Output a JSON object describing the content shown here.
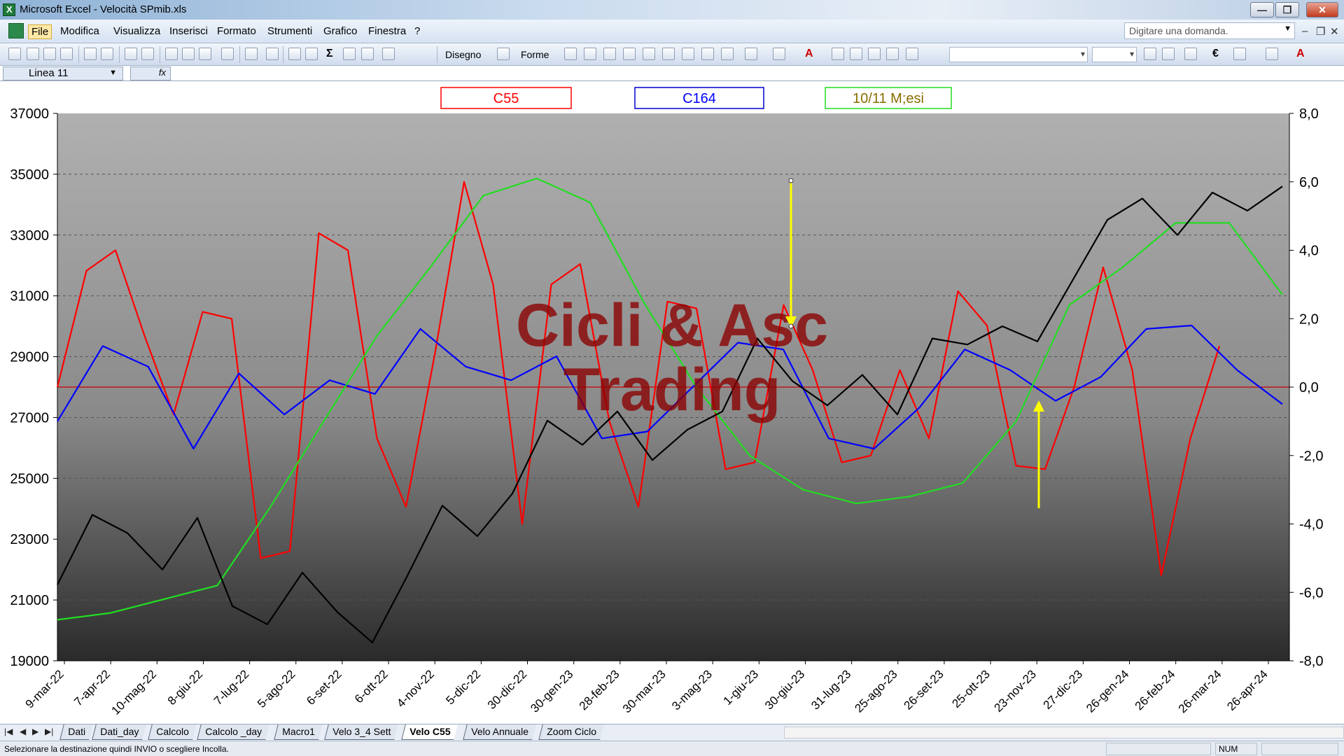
{
  "window": {
    "title": "Microsoft Excel - Velocità SPmib.xls",
    "buttons": [
      "minimize",
      "restore",
      "close"
    ]
  },
  "menu": {
    "items": [
      "File",
      "Modifica",
      "Visualizza",
      "Inserisci",
      "Formato",
      "Strumenti",
      "Grafico",
      "Finestra",
      "?"
    ],
    "active": "File",
    "question_placeholder": "Digitare una domanda."
  },
  "toolbar": {
    "draw_label": "Disegno",
    "shapes_label": "Forme",
    "sum_glyph": "Σ",
    "euro_glyph": "€",
    "font_color_glyph": "A"
  },
  "formula_bar": {
    "name_box": "Linea 11",
    "fx": "fx"
  },
  "chart_data": {
    "type": "line",
    "legend": [
      "C55",
      "C164",
      "10/11 M;esi"
    ],
    "watermark": [
      "Cicli & Asc",
      "Trading"
    ],
    "y_left": {
      "ticks": [
        "37000",
        "35000",
        "33000",
        "31000",
        "29000",
        "27000",
        "25000",
        "23000",
        "21000",
        "19000"
      ],
      "range": [
        19000,
        37000
      ]
    },
    "y_right": {
      "ticks": [
        "8,0",
        "6,0",
        "4,0",
        "2,0",
        "0,0",
        "-2,0",
        "-4,0",
        "-6,0",
        "-8,0"
      ],
      "range": [
        -8,
        8
      ]
    },
    "x_labels": [
      "9-mar-22",
      "7-apr-22",
      "10-mag-22",
      "8-giu-22",
      "7-lug-22",
      "5-ago-22",
      "6-set-22",
      "6-ott-22",
      "4-nov-22",
      "5-dic-22",
      "30-dic-22",
      "30-gen-23",
      "28-feb-23",
      "30-mar-23",
      "3-mag-23",
      "1-giu-23",
      "30-giu-23",
      "31-lug-23",
      "25-ago-23",
      "26-set-23",
      "25-ott-23",
      "23-nov-23",
      "27-dic-23",
      "26-gen-24",
      "26-feb-24",
      "26-mar-24",
      "26-apr-24"
    ],
    "series": [
      {
        "name": "C55",
        "color": "#ff0000",
        "axis": "right",
        "values": [
          0,
          3.4,
          4.0,
          1.5,
          -0.8,
          2.2,
          2.0,
          -5.0,
          -4.8,
          4.5,
          4.0,
          -1.5,
          -3.5,
          1.0,
          6.0,
          3.0,
          -4.0,
          3.0,
          3.6,
          -1.0,
          -3.5,
          2.5,
          2.3,
          -2.4,
          -2.2,
          2.4,
          0.5,
          -2.2,
          -2.0,
          0.5,
          -1.5,
          2.8,
          1.8,
          -2.3,
          -2.4,
          0,
          3.5,
          0.5,
          -5.5,
          -1.5,
          1.2
        ]
      },
      {
        "name": "C164",
        "color": "#0000ff",
        "axis": "right",
        "values": [
          -1.0,
          1.2,
          0.6,
          -1.8,
          0.4,
          -0.8,
          0.2,
          -0.2,
          1.7,
          0.6,
          0.2,
          0.9,
          -1.5,
          -1.3,
          0,
          1.3,
          1.1,
          -1.5,
          -1.8,
          -0.6,
          1.1,
          0.5,
          -0.4,
          0.3,
          1.7,
          1.8,
          0.5,
          -0.5
        ]
      },
      {
        "name": "10/11 M;esi",
        "color": "#22dd22",
        "axis": "right",
        "values": [
          -6.8,
          -6.6,
          -6.2,
          -5.8,
          -3.5,
          -1.0,
          1.5,
          3.5,
          5.6,
          6.1,
          5.4,
          2.5,
          0,
          -2.0,
          -3.0,
          -3.4,
          -3.2,
          -2.8,
          -1.0,
          2.4,
          3.5,
          4.8,
          4.8,
          2.7
        ]
      },
      {
        "name": "",
        "color": "#000000",
        "axis": "left",
        "values": [
          21500,
          23800,
          23200,
          22000,
          23700,
          20800,
          20200,
          21900,
          20600,
          19600,
          21800,
          24100,
          23100,
          24500,
          26900,
          26100,
          27200,
          25600,
          26600,
          27200,
          29600,
          28200,
          27400,
          28400,
          27100,
          29600,
          29400,
          30000,
          29500,
          31500,
          33500,
          34200,
          33000,
          34400,
          33800,
          34600
        ]
      }
    ]
  },
  "sheet_tabs": {
    "tabs": [
      "Dati",
      "Dati_day",
      "Calcolo",
      "Calcolo _day",
      "Macro1",
      "Velo 3_4 Sett",
      "Velo C55",
      "Velo Annuale",
      "Zoom Ciclo"
    ],
    "active": "Velo C55"
  },
  "status_bar": {
    "message": "Selezionare la destinazione quindi INVIO o scegliere Incolla.",
    "num": "NUM"
  }
}
